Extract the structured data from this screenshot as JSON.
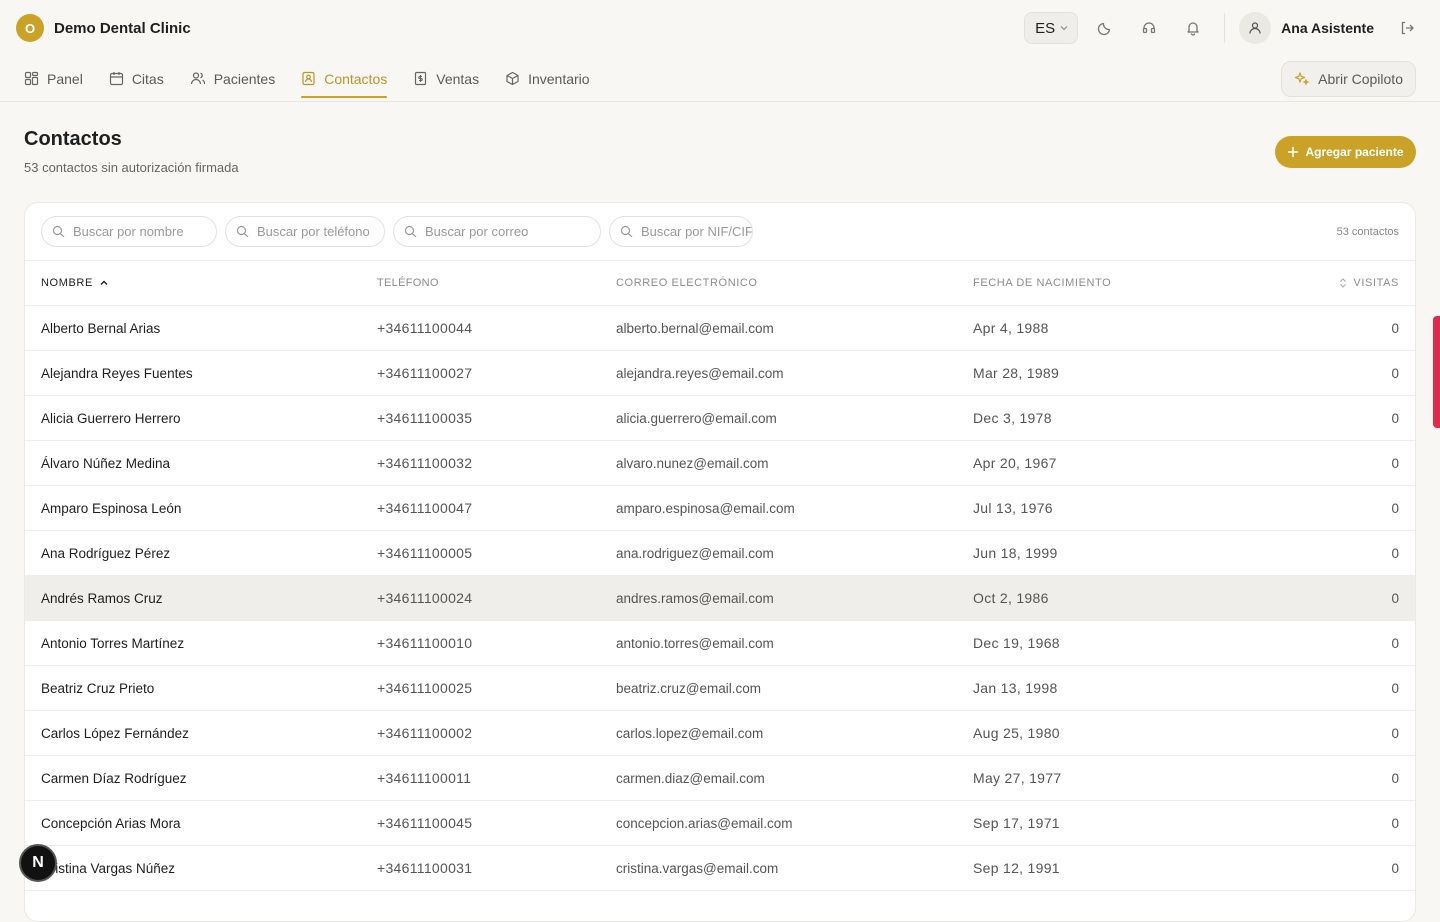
{
  "app": {
    "logo_letter": "O",
    "clinic_name": "Demo Dental Clinic"
  },
  "topbar": {
    "language": "ES",
    "user_name": "Ana Asistente"
  },
  "nav": {
    "items": [
      {
        "label": "Panel",
        "icon": "dashboard-icon"
      },
      {
        "label": "Citas",
        "icon": "calendar-icon"
      },
      {
        "label": "Pacientes",
        "icon": "users-icon"
      },
      {
        "label": "Contactos",
        "icon": "contact-book-icon",
        "active": true
      },
      {
        "label": "Ventas",
        "icon": "receipt-icon"
      },
      {
        "label": "Inventario",
        "icon": "box-icon"
      }
    ],
    "copilot_label": "Abrir Copiloto"
  },
  "page": {
    "title": "Contactos",
    "subtitle": "53 contactos sin autorización firmada",
    "add_button": "Agregar paciente"
  },
  "filters": {
    "name_placeholder": "Buscar por nombre",
    "phone_placeholder": "Buscar por teléfono",
    "email_placeholder": "Buscar por correo",
    "nif_placeholder": "Buscar por NIF/CIF",
    "count": "53 contactos"
  },
  "table": {
    "headers": {
      "name": "Nombre",
      "phone": "Teléfono",
      "email": "Correo electrónico",
      "dob": "Fecha de nacimiento",
      "visits": "Visitas"
    },
    "rows": [
      {
        "name": "Alberto Bernal Arias",
        "phone": "+34611100044",
        "email": "alberto.bernal@email.com",
        "dob": "Apr 4, 1988",
        "visits": "0"
      },
      {
        "name": "Alejandra Reyes Fuentes",
        "phone": "+34611100027",
        "email": "alejandra.reyes@email.com",
        "dob": "Mar 28, 1989",
        "visits": "0"
      },
      {
        "name": "Alicia Guerrero Herrero",
        "phone": "+34611100035",
        "email": "alicia.guerrero@email.com",
        "dob": "Dec 3, 1978",
        "visits": "0"
      },
      {
        "name": "Álvaro Núñez Medina",
        "phone": "+34611100032",
        "email": "alvaro.nunez@email.com",
        "dob": "Apr 20, 1967",
        "visits": "0"
      },
      {
        "name": "Amparo Espinosa León",
        "phone": "+34611100047",
        "email": "amparo.espinosa@email.com",
        "dob": "Jul 13, 1976",
        "visits": "0"
      },
      {
        "name": "Ana Rodríguez Pérez",
        "phone": "+34611100005",
        "email": "ana.rodriguez@email.com",
        "dob": "Jun 18, 1999",
        "visits": "0"
      },
      {
        "name": "Andrés Ramos Cruz",
        "phone": "+34611100024",
        "email": "andres.ramos@email.com",
        "dob": "Oct 2, 1986",
        "visits": "0"
      },
      {
        "name": "Antonio Torres Martínez",
        "phone": "+34611100010",
        "email": "antonio.torres@email.com",
        "dob": "Dec 19, 1968",
        "visits": "0"
      },
      {
        "name": "Beatriz Cruz Prieto",
        "phone": "+34611100025",
        "email": "beatriz.cruz@email.com",
        "dob": "Jan 13, 1998",
        "visits": "0"
      },
      {
        "name": "Carlos López Fernández",
        "phone": "+34611100002",
        "email": "carlos.lopez@email.com",
        "dob": "Aug 25, 1980",
        "visits": "0"
      },
      {
        "name": "Carmen Díaz Rodríguez",
        "phone": "+34611100011",
        "email": "carmen.diaz@email.com",
        "dob": "May 27, 1977",
        "visits": "0"
      },
      {
        "name": "Concepción Arias Mora",
        "phone": "+34611100045",
        "email": "concepcion.arias@email.com",
        "dob": "Sep 17, 1971",
        "visits": "0"
      },
      {
        "name": "Cristina Vargas Núñez",
        "phone": "+34611100031",
        "email": "cristina.vargas@email.com",
        "dob": "Sep 12, 1991",
        "visits": "0"
      }
    ]
  },
  "badge": {
    "letter": "N"
  },
  "colors": {
    "accent": "#c9a227",
    "side_tab": "#dc2d4f"
  }
}
